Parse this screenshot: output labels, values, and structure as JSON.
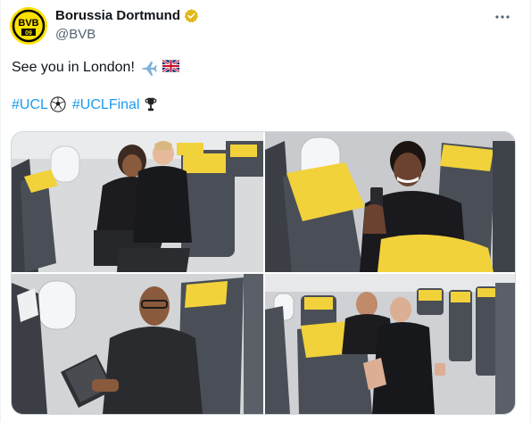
{
  "author": {
    "display_name": "Borussia Dortmund",
    "handle": "@BVB",
    "avatar_icon": "bvb-crest-icon",
    "verified_color": "#e2b719",
    "avatar_text": "BVB",
    "avatar_year": "09"
  },
  "tweet": {
    "line1": "See you in London!",
    "hashtag1": "#UCL",
    "hashtag2": "#UCLFinal"
  },
  "media": {
    "photos": [
      {
        "label": "photo-1"
      },
      {
        "label": "photo-2"
      },
      {
        "label": "photo-3"
      },
      {
        "label": "photo-4"
      }
    ],
    "headrest_color": "#f2d23a",
    "seat_color": "#4a4f57"
  },
  "colors": {
    "link": "#1d9bf0",
    "text": "#0f1419",
    "muted": "#536471"
  }
}
